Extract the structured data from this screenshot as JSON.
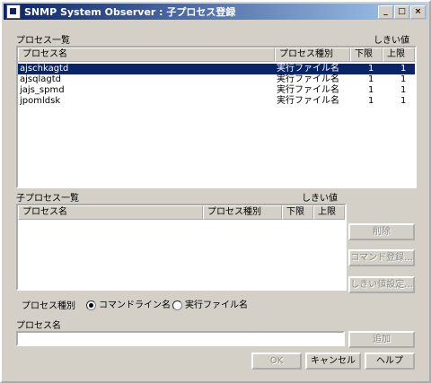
{
  "window": {
    "title": "SNMP System Observer : 子プロセス登録",
    "minimize": "_",
    "maximize": "□",
    "close": "×"
  },
  "process_list": {
    "label": "プロセス一覧",
    "threshold_label": "しきい値",
    "columns": [
      "プロセス名",
      "プロセス種別",
      "下限",
      "上限"
    ],
    "rows": [
      {
        "name": "ajschkagtd",
        "type": "実行ファイル名",
        "lower": "1",
        "upper": "1",
        "selected": true
      },
      {
        "name": "ajsqlagtd",
        "type": "実行ファイル名",
        "lower": "1",
        "upper": "1",
        "selected": false
      },
      {
        "name": "jajs_spmd",
        "type": "実行ファイル名",
        "lower": "1",
        "upper": "1",
        "selected": false
      },
      {
        "name": "jpomldsk",
        "type": "実行ファイル名",
        "lower": "1",
        "upper": "1",
        "selected": false
      }
    ]
  },
  "child_list": {
    "label": "子プロセス一覧",
    "threshold_label": "しきい値",
    "columns": [
      "プロセス名",
      "プロセス種別",
      "下限",
      "上限"
    ]
  },
  "side_buttons": {
    "delete": "削除",
    "register_command": "コマンド登録...",
    "threshold_settings": "しきい値設定..."
  },
  "process_type": {
    "label": "プロセス種別",
    "options": [
      "コマンドライン名",
      "実行ファイル名"
    ],
    "selected_index": 0
  },
  "process_name": {
    "label": "プロセス名",
    "value": "",
    "add_button": "追加"
  },
  "footer": {
    "ok": "OK",
    "cancel": "キャンセル",
    "help": "ヘルプ"
  }
}
